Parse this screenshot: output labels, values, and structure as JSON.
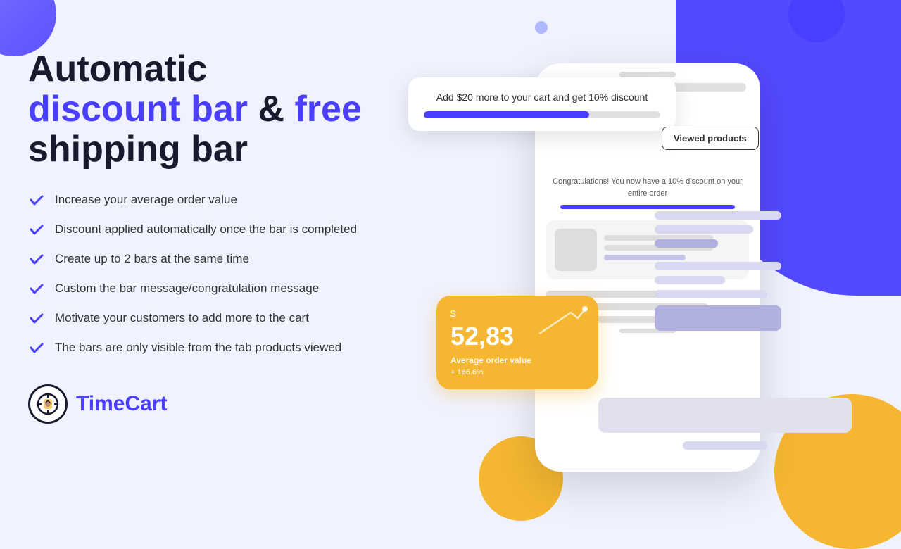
{
  "meta": {
    "title": "TimeCart - Automatic discount bar & free shipping bar"
  },
  "header": {
    "line1": "Automatic",
    "line2_part1": "discount bar",
    "line2_connector": " & ",
    "line2_part2": "free",
    "line3": "shipping bar"
  },
  "features": [
    {
      "text": "Increase your average order value"
    },
    {
      "text": "Discount applied automatically once the bar is completed"
    },
    {
      "text": "Create up to 2 bars at the same time"
    },
    {
      "text": "Custom the bar message/congratulation message"
    },
    {
      "text": "Motivate your customers to add more to the cart"
    },
    {
      "text": "The bars are only visible from the tab products viewed"
    }
  ],
  "logo": {
    "name_part1": "Time",
    "name_part2": "Cart"
  },
  "discount_card": {
    "message": "Add $20 more to your cart and get 10% discount",
    "progress_percent": 70
  },
  "viewed_products_btn": {
    "label": "Viewed products"
  },
  "congrats": {
    "text": "Congratulations! You now have a 10% discount on your entire order"
  },
  "stats_card": {
    "dollar_sign": "$",
    "amount": "52,83",
    "label": "Average order value",
    "change": "+ 166.6%"
  },
  "colors": {
    "accent_blue": "#4a3fff",
    "accent_yellow": "#f5b731",
    "text_dark": "#1a1a2e",
    "bg_light": "#f0f2ff"
  }
}
